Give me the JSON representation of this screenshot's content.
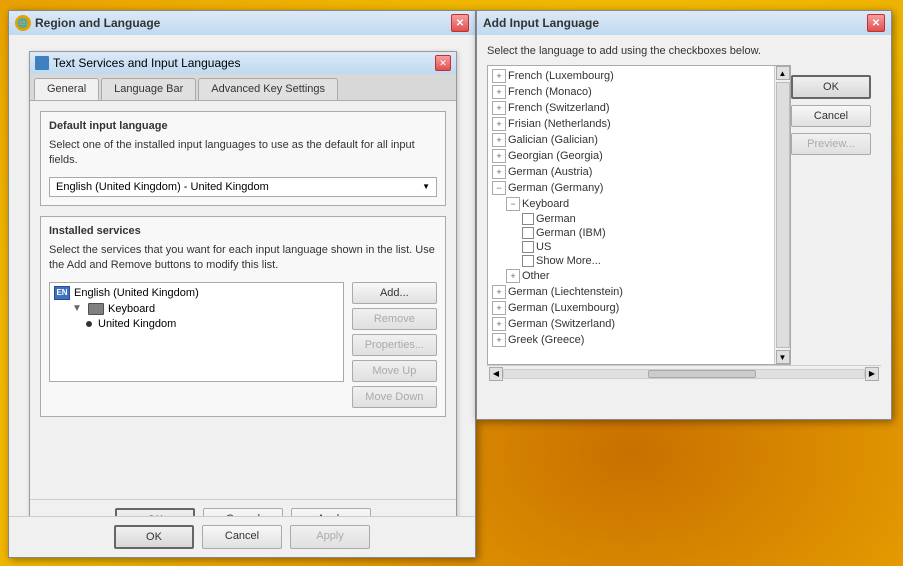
{
  "region_window": {
    "title": "Region and Language",
    "inner_title": "Text Services and Input Languages",
    "tabs": [
      "General",
      "Language Bar",
      "Advanced Key Settings"
    ],
    "active_tab": "General",
    "default_input_label": "Default input language",
    "default_input_desc": "Select one of the installed input languages to use as the default for all input fields.",
    "default_input_value": "English (United Kingdom) - United Kingdom",
    "installed_services_label": "Installed services",
    "installed_services_desc": "Select the services that you want for each input language shown in the list. Use the Add and Remove buttons to modify this list.",
    "tree_items": [
      {
        "label": "English (United Kingdom)",
        "type": "lang",
        "icon": "EN",
        "indent": 0
      },
      {
        "label": "Keyboard",
        "type": "keyboard",
        "indent": 1
      },
      {
        "label": "United Kingdom",
        "type": "item",
        "indent": 2
      }
    ],
    "buttons": {
      "add": "Add...",
      "remove": "Remove",
      "properties": "Properties...",
      "move_up": "Move Up",
      "move_down": "Move Down"
    },
    "bottom_buttons": {
      "ok": "OK",
      "cancel": "Cancel",
      "apply": "Apply"
    },
    "footer_buttons": {
      "ok": "OK",
      "cancel": "Cancel",
      "apply": "Apply"
    }
  },
  "add_lang_window": {
    "title": "Add Input Language",
    "desc": "Select the language to add using the checkboxes below.",
    "languages": [
      {
        "label": "French (Luxembourg)",
        "type": "lang",
        "expanded": false,
        "indent": 0
      },
      {
        "label": "French (Monaco)",
        "type": "lang",
        "expanded": false,
        "indent": 0
      },
      {
        "label": "French (Switzerland)",
        "type": "lang",
        "expanded": false,
        "indent": 0
      },
      {
        "label": "Frisian (Netherlands)",
        "type": "lang",
        "expanded": false,
        "indent": 0
      },
      {
        "label": "Galician (Galician)",
        "type": "lang",
        "expanded": false,
        "indent": 0
      },
      {
        "label": "Georgian (Georgia)",
        "type": "lang",
        "expanded": false,
        "indent": 0
      },
      {
        "label": "German (Austria)",
        "type": "lang",
        "expanded": false,
        "indent": 0
      },
      {
        "label": "German (Germany)",
        "type": "lang",
        "expanded": true,
        "indent": 0
      },
      {
        "label": "Keyboard",
        "type": "node",
        "expanded": true,
        "indent": 1
      },
      {
        "label": "German",
        "type": "item",
        "checked": false,
        "indent": 2
      },
      {
        "label": "German (IBM)",
        "type": "item",
        "checked": false,
        "indent": 2
      },
      {
        "label": "US",
        "type": "item",
        "checked": false,
        "indent": 2
      },
      {
        "label": "Show More...",
        "type": "item",
        "checked": false,
        "indent": 2
      },
      {
        "label": "Other",
        "type": "node",
        "expanded": false,
        "indent": 1
      },
      {
        "label": "German (Liechtenstein)",
        "type": "lang",
        "expanded": false,
        "indent": 0
      },
      {
        "label": "German (Luxembourg)",
        "type": "lang",
        "expanded": false,
        "indent": 0
      },
      {
        "label": "German (Switzerland)",
        "type": "lang",
        "expanded": false,
        "indent": 0
      },
      {
        "label": "Greek (Greece)",
        "type": "lang",
        "expanded": false,
        "indent": 0
      }
    ],
    "buttons": {
      "ok": "OK",
      "cancel": "Cancel",
      "preview": "Preview..."
    }
  }
}
